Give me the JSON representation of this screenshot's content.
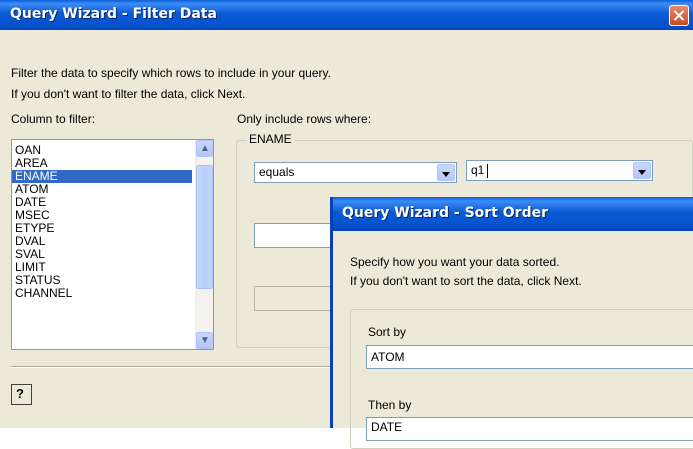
{
  "filter_window": {
    "title": "Query Wizard - Filter Data",
    "instructions": [
      "Filter the data to specify which rows to include in your query.",
      "If you don't want to filter the data, click Next."
    ],
    "column_label": "Column to filter:",
    "columns": [
      "OAN",
      "AREA",
      "ENAME",
      "ATOM",
      "DATE",
      "MSEC",
      "ETYPE",
      "DVAL",
      "SVAL",
      "LIMIT",
      "STATUS",
      "CHANNEL"
    ],
    "selected_column": "ENAME",
    "criteria_label": "Only include rows where:",
    "criteria_group": "ENAME",
    "operator_value": "equals",
    "value_value": "q1",
    "help_icon": "?"
  },
  "sort_window": {
    "title": "Query Wizard - Sort Order",
    "instructions": [
      "Specify how you want your data sorted.",
      "If you don't want to sort the data, click Next."
    ],
    "sort_by_label": "Sort by",
    "sort_by_value": "ATOM",
    "then_by_label": "Then by",
    "then_by_value": "DATE"
  },
  "icons": {
    "close": "close-icon",
    "help": "help-icon",
    "scroll_up": "scroll-up-icon",
    "scroll_down": "scroll-down-icon",
    "dropdown": "dropdown-arrow-icon"
  },
  "colors": {
    "titlebar": "#0a5ad4",
    "selection": "#316ac5",
    "dialog_bg": "#ece9d8",
    "close_button": "#c94a23"
  }
}
